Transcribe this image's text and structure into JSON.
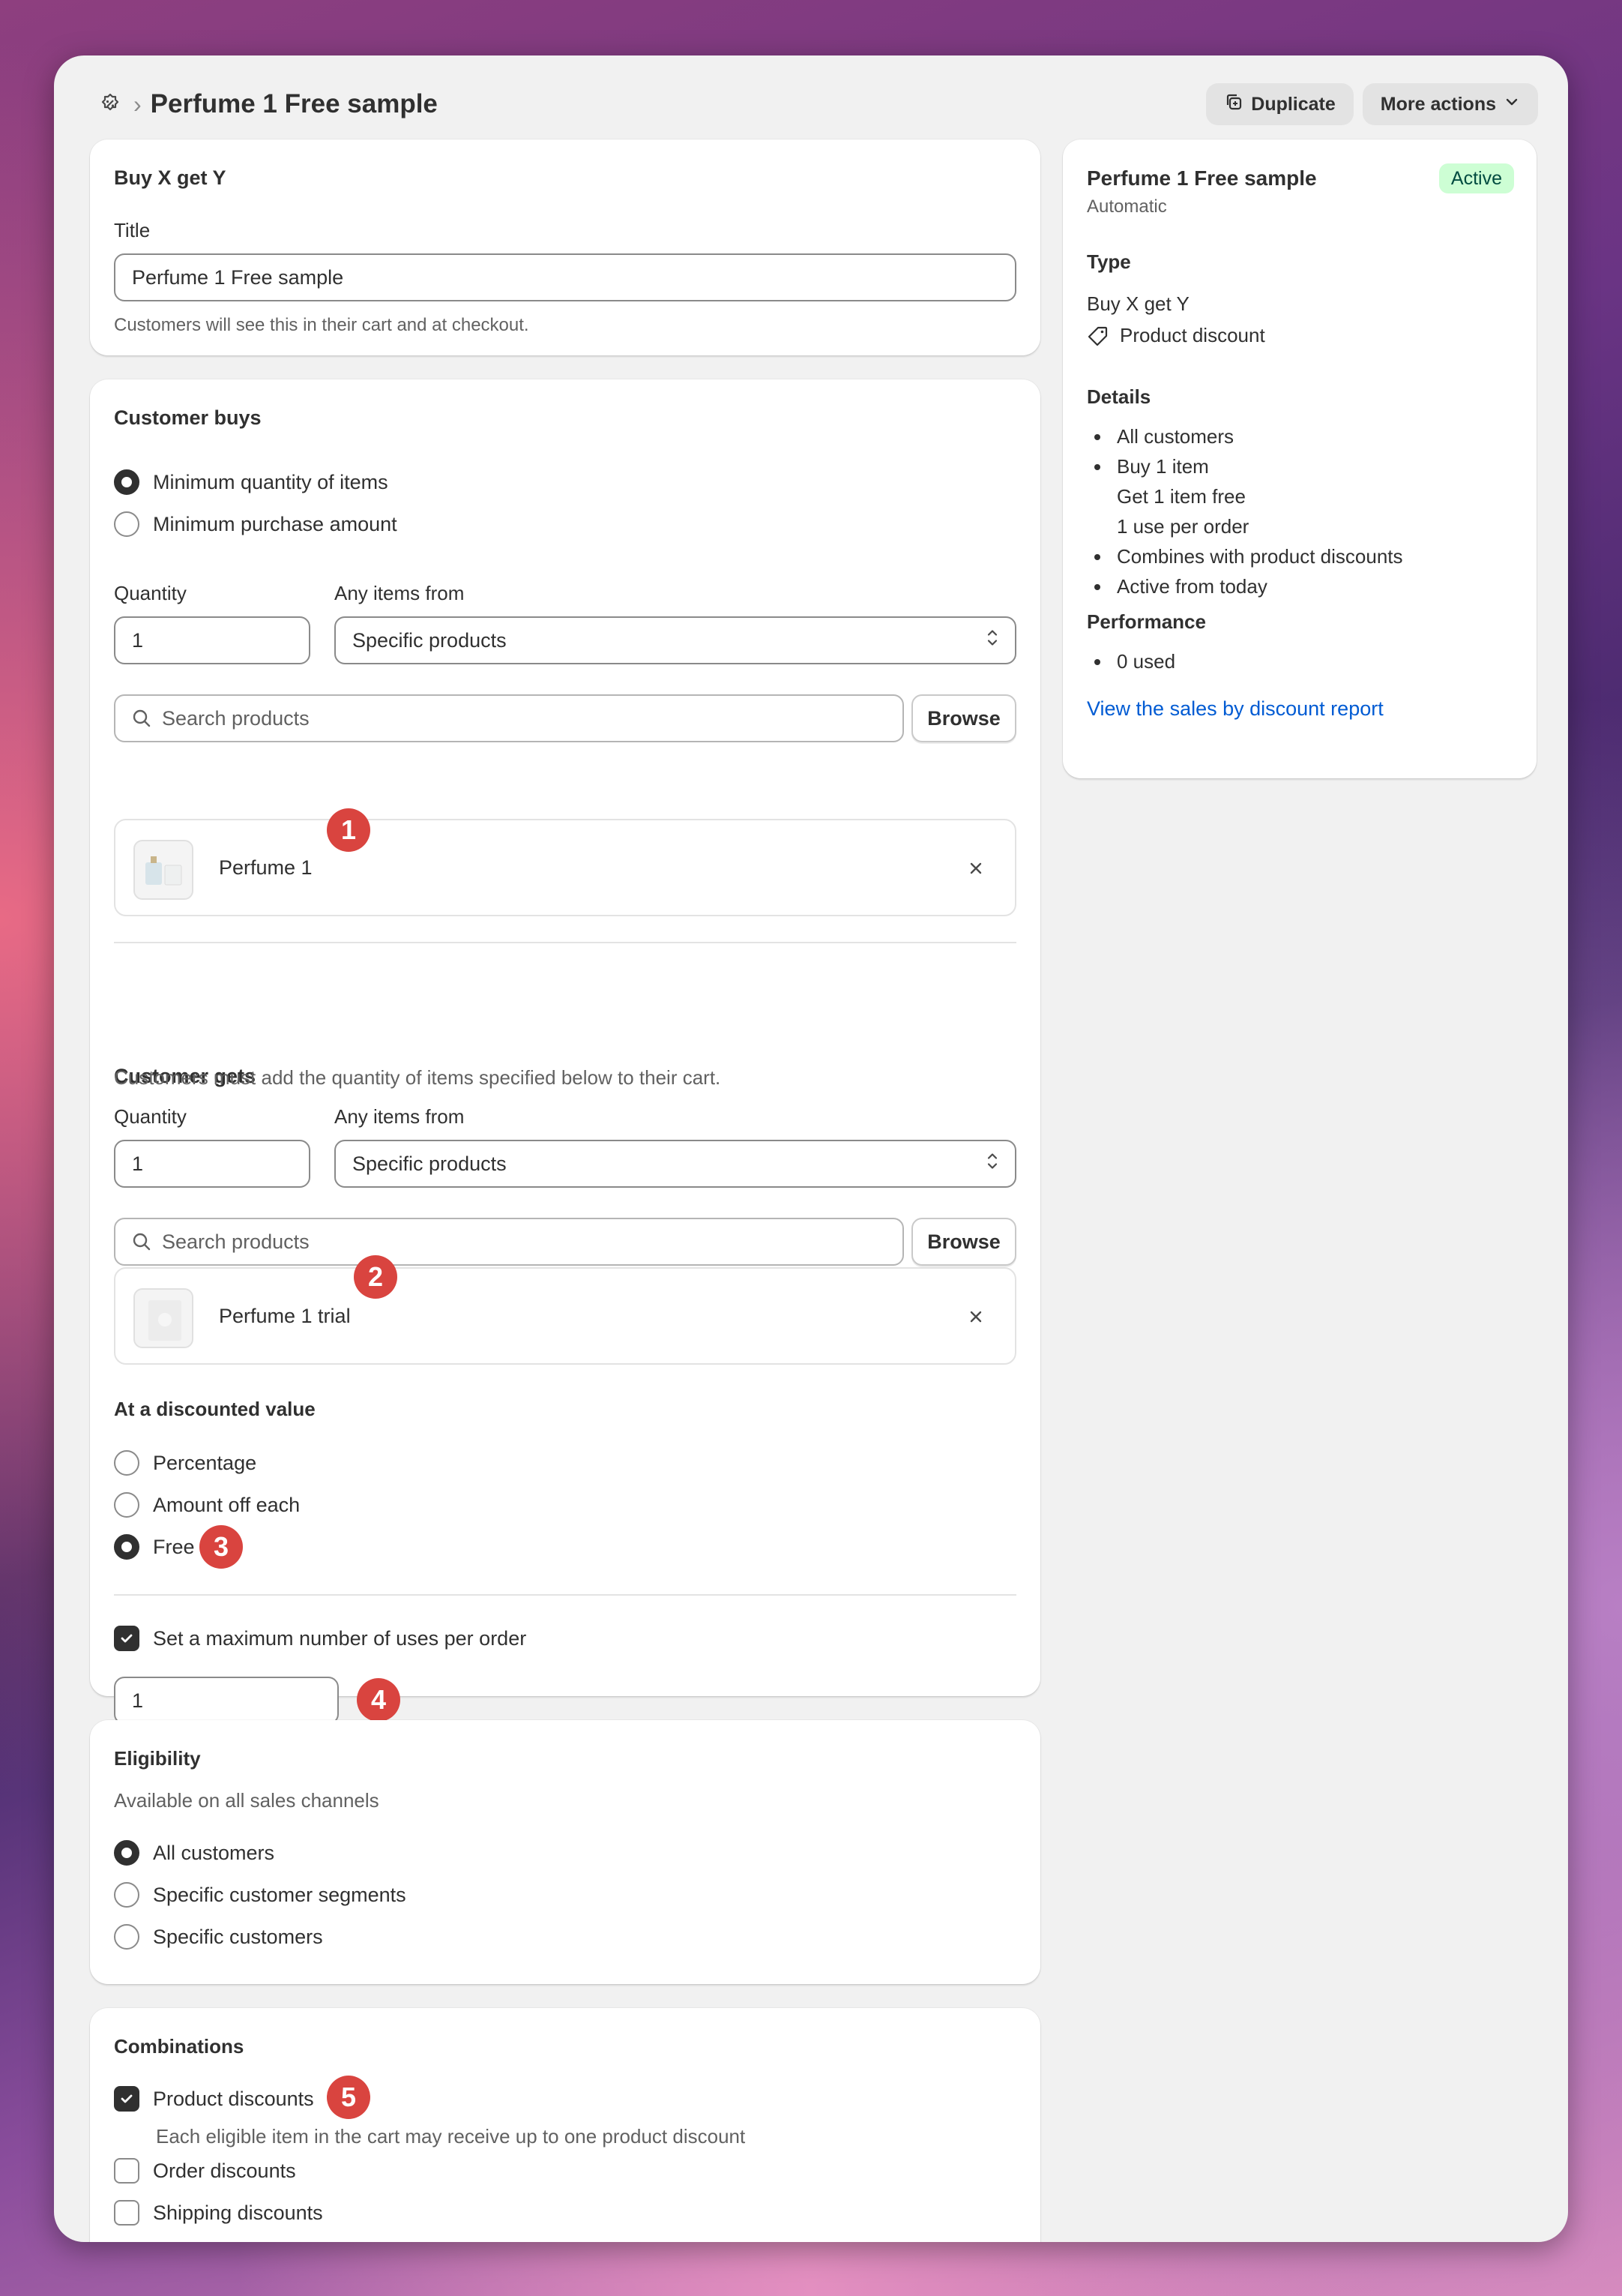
{
  "header": {
    "title": "Perfume 1 Free sample",
    "duplicate_label": "Duplicate",
    "more_actions_label": "More actions"
  },
  "basics": {
    "heading": "Buy X get Y",
    "title_label": "Title",
    "title_value": "Perfume 1 Free sample",
    "title_help": "Customers will see this in their cart and at checkout."
  },
  "customer_buys": {
    "heading": "Customer buys",
    "options": [
      "Minimum quantity of items",
      "Minimum purchase amount"
    ],
    "selected_option": "Minimum quantity of items",
    "quantity_label": "Quantity",
    "quantity_value": "1",
    "items_from_label": "Any items from",
    "items_from_value": "Specific products",
    "search_placeholder": "Search products",
    "browse_label": "Browse",
    "product_name": "Perfume 1",
    "marker": "1"
  },
  "customer_gets": {
    "heading": "Customer gets",
    "description": "Customers must add the quantity of items specified below to their cart.",
    "quantity_label": "Quantity",
    "quantity_value": "1",
    "items_from_label": "Any items from",
    "items_from_value": "Specific products",
    "search_placeholder": "Search products",
    "browse_label": "Browse",
    "product_name": "Perfume 1 trial",
    "marker": "2",
    "discount_heading": "At a discounted value",
    "discount_options": [
      "Percentage",
      "Amount off each",
      "Free"
    ],
    "discount_selected": "Free",
    "discount_marker": "3",
    "max_uses_label": "Set a maximum number of uses per order",
    "max_uses_checked": true,
    "max_uses_value": "1",
    "max_uses_marker": "4"
  },
  "eligibility": {
    "heading": "Eligibility",
    "subtitle": "Available on all sales channels",
    "options": [
      "All customers",
      "Specific customer segments",
      "Specific customers"
    ],
    "selected": "All customers"
  },
  "combinations": {
    "heading": "Combinations",
    "product_label": "Product discounts",
    "product_checked": true,
    "product_help": "Each eligible item in the cart may receive up to one product discount",
    "product_marker": "5",
    "order_label": "Order discounts",
    "order_checked": false,
    "shipping_label": "Shipping discounts",
    "shipping_checked": false
  },
  "summary": {
    "title": "Perfume 1 Free sample",
    "method": "Automatic",
    "status": "Active",
    "type_heading": "Type",
    "type_value": "Buy X get Y",
    "type_kind": "Product discount",
    "details_heading": "Details",
    "details": [
      "All customers",
      "Buy 1 item",
      "Get 1 item free",
      "1 use per order",
      "Combines with product discounts",
      "Active from today"
    ],
    "performance_heading": "Performance",
    "performance": [
      "0 used"
    ],
    "report_link": "View the sales by discount report"
  },
  "colors": {
    "marker": "#d9443f",
    "status_bg": "#cdfed4",
    "status_text": "#014b40",
    "link": "#005bd3"
  }
}
